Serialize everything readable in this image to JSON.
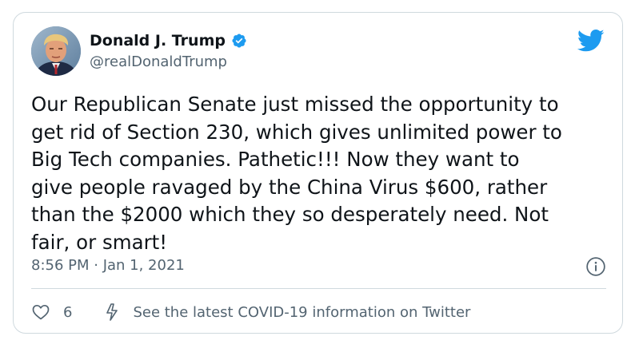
{
  "tweet": {
    "author": {
      "display_name": "Donald J. Trump",
      "handle": "@realDonaldTrump",
      "verified": true
    },
    "text": "Our Republican Senate just missed the opportunity to\nget rid of Section 230, which gives unlimited power to\nBig Tech companies. Pathetic!!! Now they want to\ngive people ravaged by the China Virus $600, rather\nthan the $2000 which they so desperately need. Not\nfair, or smart!",
    "timestamp": "8:56 PM · Jan 1, 2021",
    "like_count": "6",
    "covid_link": "See the latest COVID-19 information on Twitter"
  },
  "icons": {
    "brand": "twitter-bird-icon",
    "verified": "verified-badge-icon",
    "info": "info-icon",
    "like": "heart-icon",
    "covid": "bolt-icon"
  },
  "colors": {
    "brand": "#1d9bf0",
    "text": "#0f1419",
    "secondary": "#536471",
    "border": "#cfd9de"
  }
}
